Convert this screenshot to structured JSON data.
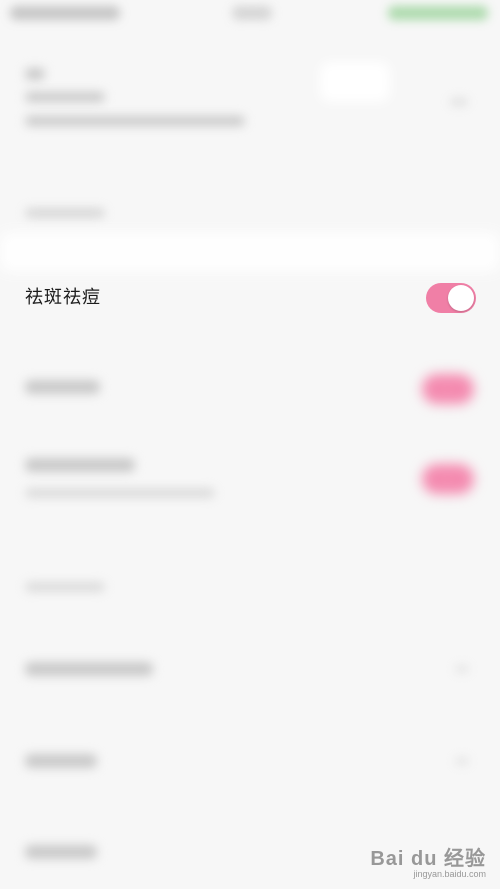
{
  "setting": {
    "label": "祛斑祛痘",
    "enabled": true
  },
  "colors": {
    "background": "#f7f7f7",
    "toggle_on": "#f07fa6"
  },
  "watermark": {
    "main": "Bai du 经验",
    "sub": "jingyan.baidu.com"
  }
}
